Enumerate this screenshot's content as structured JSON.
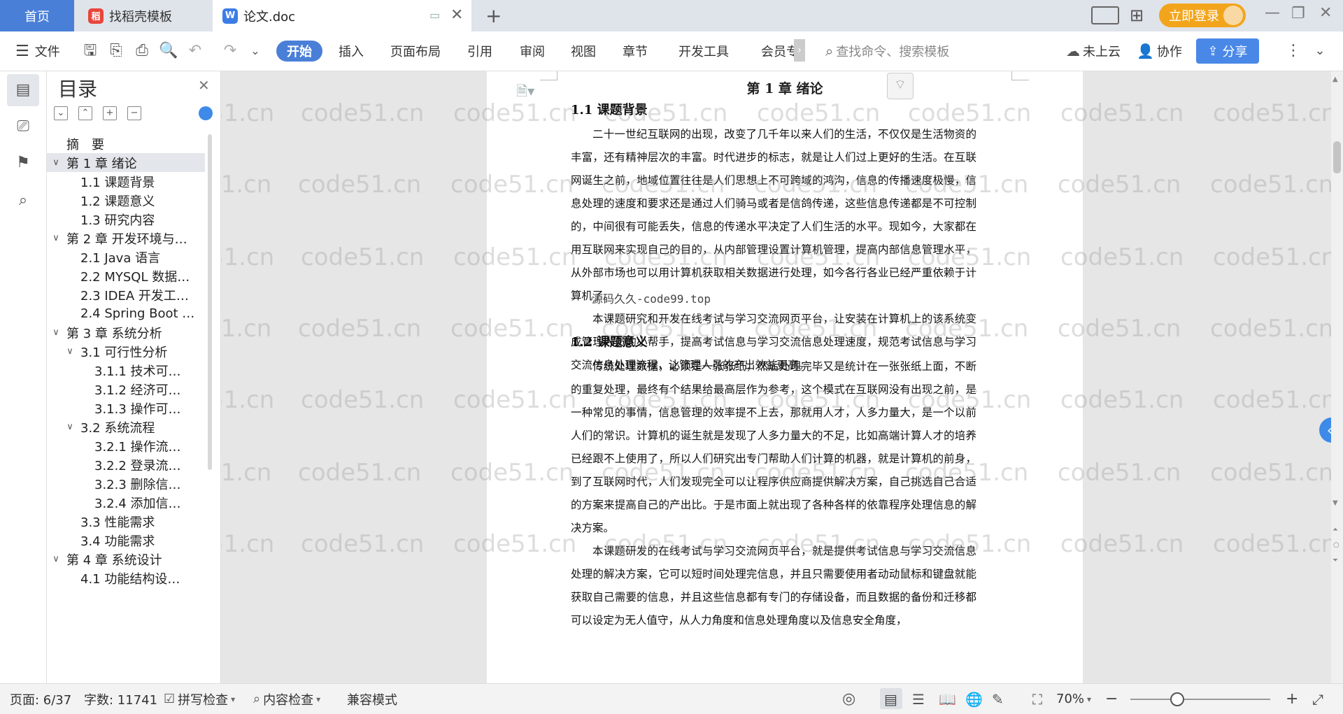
{
  "tabs": {
    "home": "首页",
    "templates": "找稻壳模板",
    "document": "论文.doc",
    "new_tab": "+"
  },
  "titlebar": {
    "login": "立即登录"
  },
  "toolbar": {
    "file": "文件",
    "menus": [
      "开始",
      "插入",
      "页面布局",
      "引用",
      "审阅",
      "视图",
      "章节",
      "开发工具",
      "会员专"
    ],
    "search_placeholder": "查找命令、搜索模板",
    "cloud": "未上云",
    "collab": "协作",
    "share": "分享"
  },
  "toc": {
    "title": "目录",
    "items": [
      {
        "label": "摘　要",
        "level": 1,
        "expanded": null
      },
      {
        "label": "第 1 章  绪论",
        "level": 1,
        "expanded": true,
        "selected": true
      },
      {
        "label": "1.1  课题背景",
        "level": 2
      },
      {
        "label": "1.2  课题意义",
        "level": 2
      },
      {
        "label": "1.3  研究内容",
        "level": 2
      },
      {
        "label": "第 2 章  开发环境与…",
        "level": 1,
        "expanded": true
      },
      {
        "label": "2.1 Java 语言",
        "level": 2
      },
      {
        "label": "2.2 MYSQL 数据…",
        "level": 2
      },
      {
        "label": "2.3 IDEA 开发工…",
        "level": 2
      },
      {
        "label": "2.4 Spring Boot …",
        "level": 2
      },
      {
        "label": "第 3 章  系统分析",
        "level": 1,
        "expanded": true
      },
      {
        "label": "3.1  可行性分析",
        "level": 2,
        "expanded": true
      },
      {
        "label": "3.1.1  技术可…",
        "level": 3
      },
      {
        "label": "3.1.2  经济可…",
        "level": 3
      },
      {
        "label": "3.1.3  操作可…",
        "level": 3
      },
      {
        "label": "3.2  系统流程",
        "level": 2,
        "expanded": true
      },
      {
        "label": "3.2.1  操作流…",
        "level": 3
      },
      {
        "label": "3.2.2  登录流…",
        "level": 3
      },
      {
        "label": "3.2.3  删除信…",
        "level": 3
      },
      {
        "label": "3.2.4  添加信…",
        "level": 3
      },
      {
        "label": "3.3  性能需求",
        "level": 2
      },
      {
        "label": "3.4  功能需求",
        "level": 2
      },
      {
        "label": "第 4 章  系统设计",
        "level": 1,
        "expanded": true
      },
      {
        "label": "4.1  功能结构设…",
        "level": 2
      }
    ]
  },
  "document": {
    "chapter": "第 1 章  绪论",
    "sec1_title": "1.1  课题背景",
    "sec1_p1": "二十一世纪互联网的出现，改变了几千年以来人们的生活，不仅仅是生活物资的丰富，还有精神层次的丰富。时代进步的标志，就是让人们过上更好的生活。在互联网诞生之前，地域位置往往是人们思想上不可跨域的鸿沟，信息的传播速度极慢，信息处理的速度和要求还是通过人们骑马或者是信鸽传递，这些信息传递都是不可控制的，中间很有可能丢失，信息的传递水平决定了人们生活的水平。现如今，大家都在用互联网来实现自己的目的，从内部管理设置计算机管理，提高内部信息管理水平，从外部市场也可以用计算机获取相关数据进行处理，如今各行各业已经严重依赖于计算机了。",
    "sec1_p2": "本课题研究和开发在线考试与学习交流网页平台，让安装在计算机上的该系统变成管理人员的小帮手，提高考试信息与学习交流信息处理速度，规范考试信息与学习交流信息处理流程，让管理人员的产出效益更高。",
    "sec2_title": "1.2  课题意义",
    "sec2_p1": "传统处理数据，必须是一张张纸，然后处理完毕又是统计在一张张纸上面，不断的重复处理，最终有个结果给最高层作为参考，这个模式在互联网没有出现之前，是一种常见的事情，信息管理的效率提不上去，那就用人才，人多力量大，是一个以前人们的常识。计算机的诞生就是发现了人多力量大的不足，比如高端计算人才的培养已经跟不上使用了，所以人们研究出专门帮助人们计算的机器，就是计算机的前身，到了互联网时代，人们发现完全可以让程序供应商提供解决方案，自己挑选自己合适的方案来提高自己的产出比。于是市面上就出现了各种各样的依靠程序处理信息的解决方案。",
    "sec2_p2": "本课题研发的在线考试与学习交流网页平台，就是提供考试信息与学习交流信息处理的解决方案，它可以短时间处理完信息，并且只需要使用者动动鼠标和键盘就能获取自己需要的信息，并且这些信息都有专门的存储设备，而且数据的备份和迁移都可以设定为无人值守，从人力角度和信息处理角度以及信息安全角度，",
    "overlay_text": "源码久久-code99.top",
    "watermark": "code51.cn"
  },
  "statusbar": {
    "page": "页面: 6/37",
    "words": "字数: 11741",
    "spell": "拼写检查",
    "content_check": "内容检查",
    "compat": "兼容模式",
    "zoom": "70%"
  }
}
